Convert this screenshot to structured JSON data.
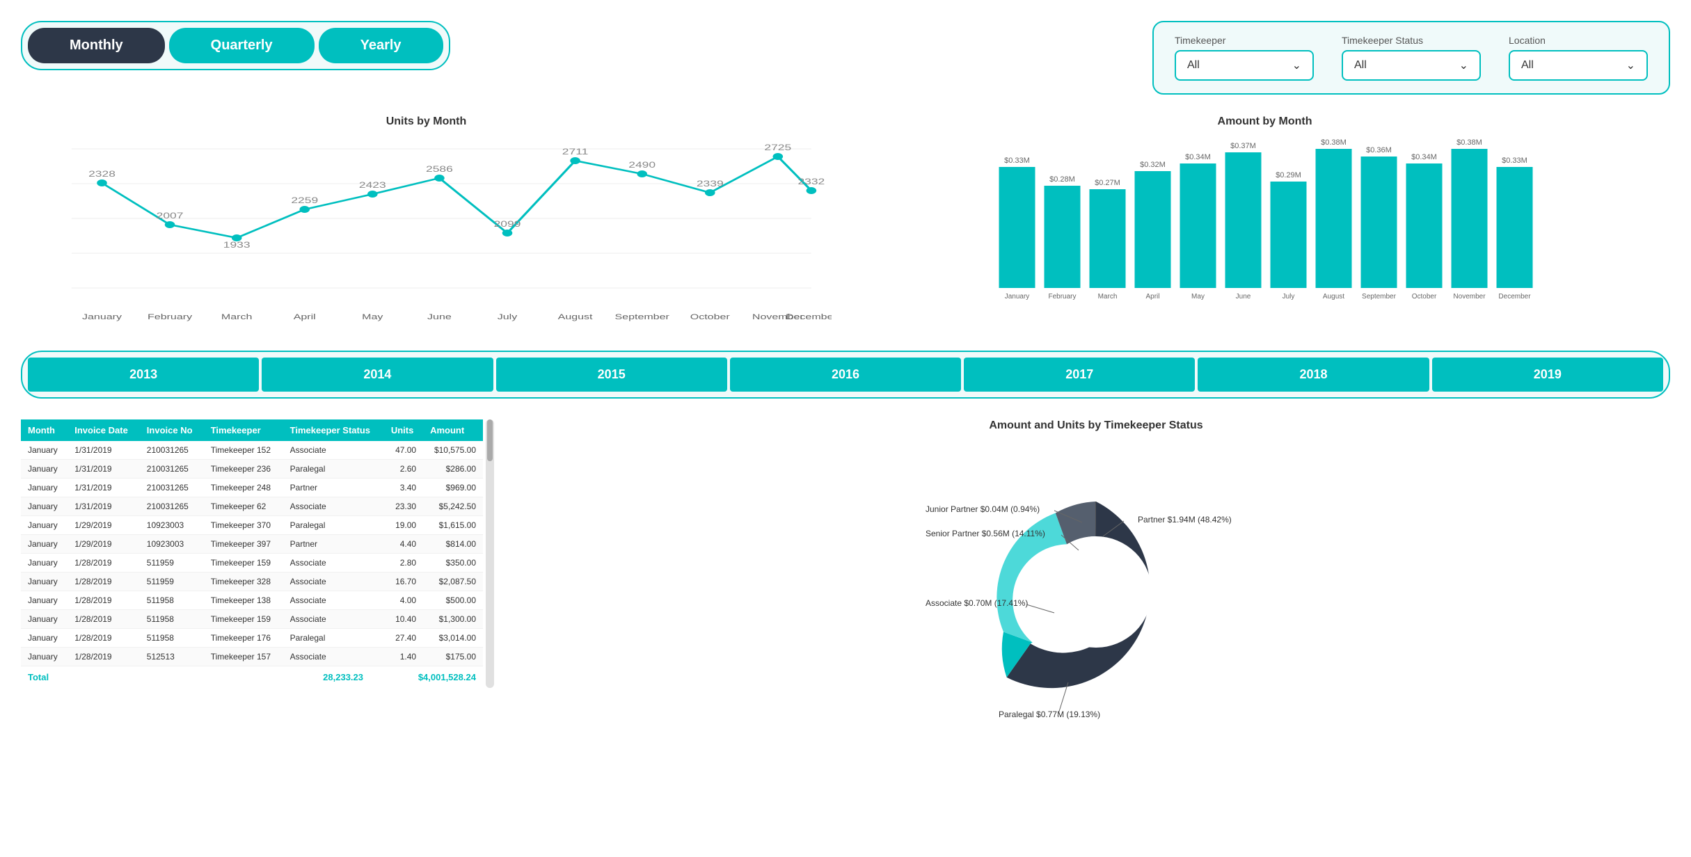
{
  "period_toggle": {
    "buttons": [
      {
        "label": "Monthly",
        "state": "active"
      },
      {
        "label": "Quarterly",
        "state": "teal"
      },
      {
        "label": "Yearly",
        "state": "teal"
      }
    ]
  },
  "filters": {
    "timekeeper": {
      "label": "Timekeeper",
      "value": "All"
    },
    "timekeeper_status": {
      "label": "Timekeeper Status",
      "value": "All"
    },
    "location": {
      "label": "Location",
      "value": "All"
    }
  },
  "line_chart": {
    "title": "Units by Month",
    "data": [
      {
        "month": "January",
        "value": 2328
      },
      {
        "month": "February",
        "value": 2007
      },
      {
        "month": "March",
        "value": 1933
      },
      {
        "month": "April",
        "value": 2259
      },
      {
        "month": "May",
        "value": 2423
      },
      {
        "month": "June",
        "value": 2586
      },
      {
        "month": "July",
        "value": 2099
      },
      {
        "month": "August",
        "value": 2711
      },
      {
        "month": "September",
        "value": 2490
      },
      {
        "month": "October",
        "value": 2339
      },
      {
        "month": "November",
        "value": 2725
      },
      {
        "month": "December",
        "value": 2332
      }
    ]
  },
  "bar_chart": {
    "title": "Amount by Month",
    "data": [
      {
        "month": "January",
        "value": 0.33,
        "label": "$0.33M"
      },
      {
        "month": "February",
        "value": 0.28,
        "label": "$0.28M"
      },
      {
        "month": "March",
        "value": 0.27,
        "label": "$0.27M"
      },
      {
        "month": "April",
        "value": 0.32,
        "label": "$0.32M"
      },
      {
        "month": "May",
        "value": 0.34,
        "label": "$0.34M"
      },
      {
        "month": "June",
        "value": 0.37,
        "label": "$0.37M"
      },
      {
        "month": "July",
        "value": 0.29,
        "label": "$0.29M"
      },
      {
        "month": "August",
        "value": 0.38,
        "label": "$0.38M"
      },
      {
        "month": "September",
        "value": 0.36,
        "label": "$0.36M"
      },
      {
        "month": "October",
        "value": 0.34,
        "label": "$0.34M"
      },
      {
        "month": "November",
        "value": 0.38,
        "label": "$0.38M"
      },
      {
        "month": "December",
        "value": 0.33,
        "label": "$0.33M"
      }
    ]
  },
  "years": [
    "2013",
    "2014",
    "2015",
    "2016",
    "2017",
    "2018",
    "2019"
  ],
  "table": {
    "headers": [
      "Month",
      "Invoice Date",
      "Invoice No",
      "Timekeeper",
      "Timekeeper Status",
      "Units",
      "Amount"
    ],
    "rows": [
      [
        "January",
        "1/31/2019",
        "210031265",
        "Timekeeper 152",
        "Associate",
        "47.00",
        "$10,575.00"
      ],
      [
        "January",
        "1/31/2019",
        "210031265",
        "Timekeeper 236",
        "Paralegal",
        "2.60",
        "$286.00"
      ],
      [
        "January",
        "1/31/2019",
        "210031265",
        "Timekeeper 248",
        "Partner",
        "3.40",
        "$969.00"
      ],
      [
        "January",
        "1/31/2019",
        "210031265",
        "Timekeeper 62",
        "Associate",
        "23.30",
        "$5,242.50"
      ],
      [
        "January",
        "1/29/2019",
        "10923003",
        "Timekeeper 370",
        "Paralegal",
        "19.00",
        "$1,615.00"
      ],
      [
        "January",
        "1/29/2019",
        "10923003",
        "Timekeeper 397",
        "Partner",
        "4.40",
        "$814.00"
      ],
      [
        "January",
        "1/28/2019",
        "511959",
        "Timekeeper 159",
        "Associate",
        "2.80",
        "$350.00"
      ],
      [
        "January",
        "1/28/2019",
        "511959",
        "Timekeeper 328",
        "Associate",
        "16.70",
        "$2,087.50"
      ],
      [
        "January",
        "1/28/2019",
        "511958",
        "Timekeeper 138",
        "Associate",
        "4.00",
        "$500.00"
      ],
      [
        "January",
        "1/28/2019",
        "511958",
        "Timekeeper 159",
        "Associate",
        "10.40",
        "$1,300.00"
      ],
      [
        "January",
        "1/28/2019",
        "511958",
        "Timekeeper 176",
        "Paralegal",
        "27.40",
        "$3,014.00"
      ],
      [
        "January",
        "1/28/2019",
        "512513",
        "Timekeeper 157",
        "Associate",
        "1.40",
        "$175.00"
      ]
    ],
    "footer_label": "Total",
    "footer_units": "28,233.23",
    "footer_amount": "$4,001,528.24"
  },
  "donut_chart": {
    "title": "Amount and Units by Timekeeper Status",
    "segments": [
      {
        "label": "Partner",
        "value": 48.42,
        "amount": "$1.94M",
        "color": "#2d3748"
      },
      {
        "label": "Paralegal",
        "value": 19.13,
        "amount": "$0.77M",
        "color": "#00bfbf"
      },
      {
        "label": "Associate",
        "value": 17.41,
        "amount": "$0.70M",
        "color": "#4dd9d9"
      },
      {
        "label": "Senior Partner",
        "value": 14.11,
        "amount": "$0.56M",
        "color": "#555f6e"
      },
      {
        "label": "Junior Partner",
        "value": 0.94,
        "amount": "$0.04M",
        "color": "#333"
      }
    ]
  }
}
